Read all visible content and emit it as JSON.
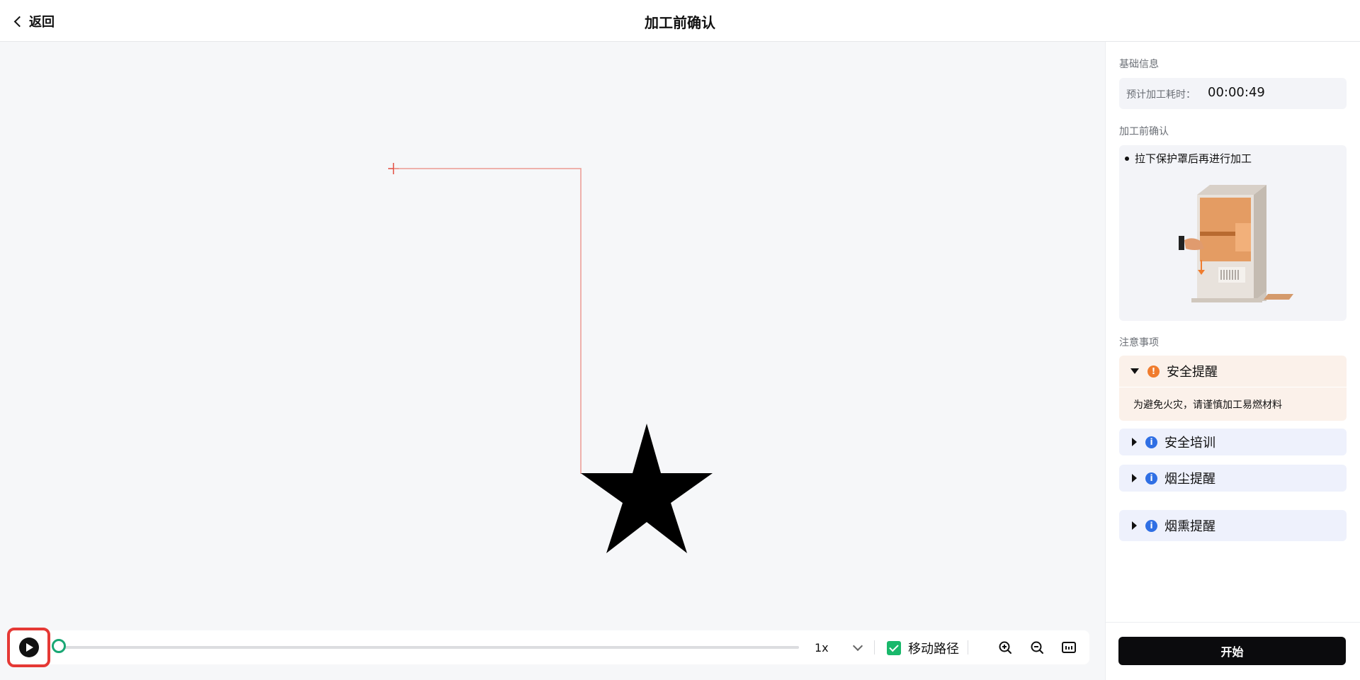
{
  "header": {
    "back_label": "返回",
    "title": "加工前确认"
  },
  "playback": {
    "speed": "1x",
    "move_path_label": "移动路径",
    "move_path_checked": true,
    "progress": 0
  },
  "panel": {
    "basic_info_label": "基础信息",
    "estimated_time_label": "预计加工耗时：",
    "estimated_time_value": "00:00:49",
    "pre_confirm_label": "加工前确认",
    "pre_confirm_item": "拉下保护罩后再进行加工",
    "notes_label": "注意事项",
    "notes": [
      {
        "title": "安全提醒",
        "expanded": true,
        "type": "warning",
        "body": "为避免火灾，请谨慎加工易燃材料"
      },
      {
        "title": "安全培训",
        "expanded": false,
        "type": "info"
      },
      {
        "title": "烟尘提醒",
        "expanded": false,
        "type": "info"
      },
      {
        "title": "烟熏提醒",
        "expanded": false,
        "type": "info"
      }
    ],
    "start_button": "开始"
  },
  "icons": {
    "back": "chevron-left-icon",
    "play": "play-icon",
    "dropdown": "chevron-down-icon",
    "zoom_in": "zoom-in-icon",
    "zoom_out": "zoom-out-icon",
    "fit": "fit-screen-icon",
    "warning": "exclamation-icon",
    "info": "info-icon"
  },
  "colors": {
    "accent_green": "#19b86b",
    "warning_orange": "#f07c2e",
    "info_blue": "#2f6fe4",
    "path_red": "#e8837a",
    "highlight_red": "#e53935"
  }
}
